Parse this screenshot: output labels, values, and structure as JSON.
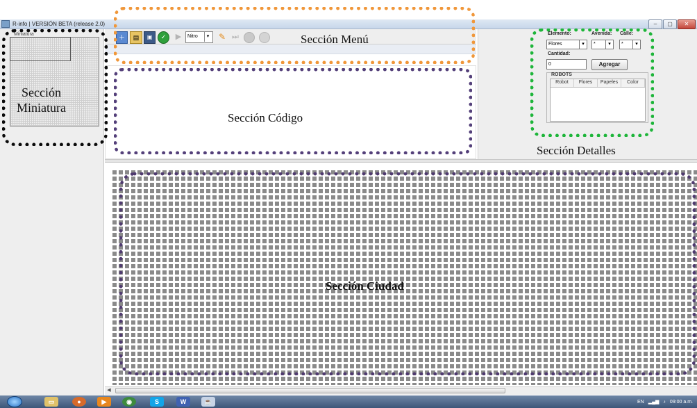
{
  "window": {
    "title": "R-info  |  VERSIÓN BETA (release 2.0)",
    "buttons": {
      "minimize": "–",
      "maximize": "▢",
      "close": "✕"
    }
  },
  "miniature": {
    "header_label": "Miniatura",
    "section_label_line1": "Sección",
    "section_label_line2": "Miniatura"
  },
  "toolbar": {
    "new_icon": "new-file-icon",
    "open_icon": "open-folder-icon",
    "save_icon": "save-icon",
    "check_icon": "check-icon",
    "play_symbol": "▶",
    "mode_select": "Nitro",
    "select_arrow": "▾",
    "edit_symbol": "✎",
    "step_symbol": "⏭",
    "section_label": "Sección  Menú"
  },
  "code": {
    "section_label": "Sección Código"
  },
  "details": {
    "elemento_label": "Elemento:",
    "avenida_label": "Avenida:",
    "calle_label": "Calle:",
    "elemento_value": "Flores",
    "avenida_value": "*",
    "calle_value": "*",
    "dropdown_arrow": "▾",
    "cantidad_label": "Cantidad:",
    "cantidad_value": "0",
    "agregar_button": "Agregar",
    "robots_title": "ROBOTS",
    "robots_columns": [
      "Robot",
      "Flores",
      "Papeles",
      "Color"
    ],
    "section_label": "Sección Detalles"
  },
  "city": {
    "section_label": "Sección Ciudad",
    "scroll_left": "◀"
  },
  "taskbar": {
    "tray_lang": "EN",
    "clock": "09:00 a.m."
  },
  "colors": {
    "menu_outline": "#f0973a",
    "miniature_outline": "#0a0a0a",
    "code_outline": "#54407a",
    "details_outline": "#1eb53a",
    "city_outline": "#4f3a6f"
  }
}
